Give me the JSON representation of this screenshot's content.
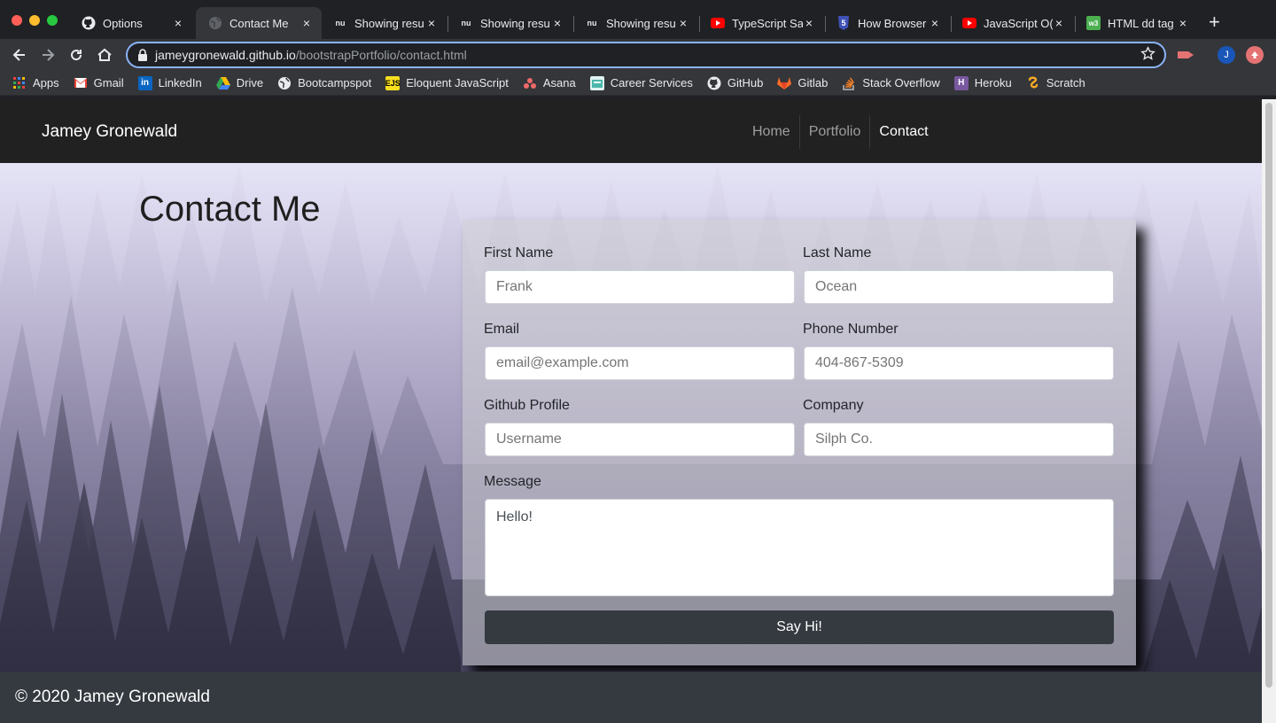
{
  "browser": {
    "tabs": [
      {
        "title": "Options",
        "icon": "github-icon"
      },
      {
        "title": "Contact Me",
        "icon": "globe-icon"
      },
      {
        "title": "Showing resu",
        "icon": "nu-icon"
      },
      {
        "title": "Showing resu",
        "icon": "nu-icon"
      },
      {
        "title": "Showing resu",
        "icon": "nu-icon"
      },
      {
        "title": "TypeScript Sa",
        "icon": "youtube-icon"
      },
      {
        "title": "How Browser",
        "icon": "css3-icon"
      },
      {
        "title": "JavaScript O(",
        "icon": "youtube-icon"
      },
      {
        "title": "HTML dd tag",
        "icon": "w3-icon"
      }
    ],
    "new_tab": "+",
    "close_glyph": "×",
    "address": {
      "host": "jameygronewald.github.io",
      "path": "/bootstrapPortfolio/contact.html"
    },
    "profile_initial": "J",
    "bookmarks": [
      {
        "label": "Apps",
        "icon": "apps-grid-icon"
      },
      {
        "label": "Gmail",
        "icon": "gmail-icon"
      },
      {
        "label": "LinkedIn",
        "icon": "linkedin-icon"
      },
      {
        "label": "Drive",
        "icon": "drive-icon"
      },
      {
        "label": "Bootcampspot",
        "icon": "globe-icon"
      },
      {
        "label": "Eloquent JavaScript",
        "icon": "ejs-icon"
      },
      {
        "label": "Asana",
        "icon": "asana-icon"
      },
      {
        "label": "Career Services",
        "icon": "career-icon"
      },
      {
        "label": "GitHub",
        "icon": "github-icon"
      },
      {
        "label": "Gitlab",
        "icon": "gitlab-icon"
      },
      {
        "label": "Stack Overflow",
        "icon": "stackoverflow-icon"
      },
      {
        "label": "Heroku",
        "icon": "heroku-icon"
      },
      {
        "label": "Scratch",
        "icon": "scratch-icon"
      }
    ]
  },
  "site": {
    "brand": "Jamey Gronewald",
    "nav": [
      "Home",
      "Portfolio",
      "Contact"
    ],
    "page_title": "Contact Me",
    "form": {
      "first_name": {
        "label": "First Name",
        "placeholder": "Frank"
      },
      "last_name": {
        "label": "Last Name",
        "placeholder": "Ocean"
      },
      "email": {
        "label": "Email",
        "placeholder": "email@example.com"
      },
      "phone": {
        "label": "Phone Number",
        "placeholder": "404-867-5309"
      },
      "github": {
        "label": "Github Profile",
        "placeholder": "Username"
      },
      "company": {
        "label": "Company",
        "placeholder": "Silph Co."
      },
      "message": {
        "label": "Message",
        "value": "Hello!"
      },
      "submit": "Say Hi!"
    },
    "footer": "© 2020 Jamey Gronewald"
  },
  "colors": {
    "navbar": "#212121",
    "footer": "#343a40",
    "button": "#343a40",
    "omnibox_focus": "#8ab4f8"
  }
}
